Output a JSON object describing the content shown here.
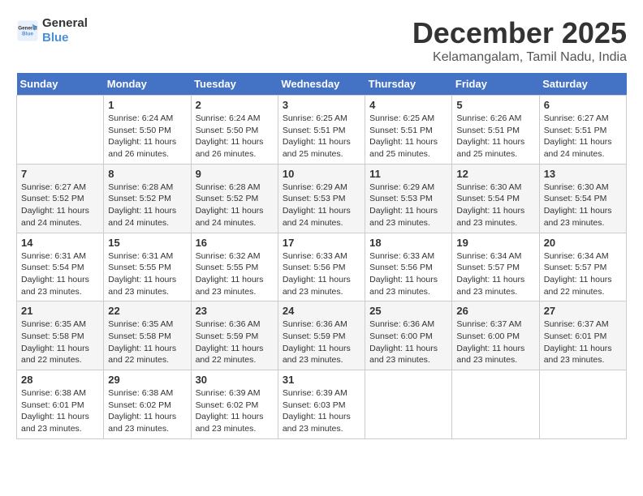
{
  "header": {
    "logo_line1": "General",
    "logo_line2": "Blue",
    "month": "December 2025",
    "location": "Kelamangalam, Tamil Nadu, India"
  },
  "weekdays": [
    "Sunday",
    "Monday",
    "Tuesday",
    "Wednesday",
    "Thursday",
    "Friday",
    "Saturday"
  ],
  "weeks": [
    [
      {
        "day": "",
        "info": ""
      },
      {
        "day": "1",
        "info": "Sunrise: 6:24 AM\nSunset: 5:50 PM\nDaylight: 11 hours\nand 26 minutes."
      },
      {
        "day": "2",
        "info": "Sunrise: 6:24 AM\nSunset: 5:50 PM\nDaylight: 11 hours\nand 26 minutes."
      },
      {
        "day": "3",
        "info": "Sunrise: 6:25 AM\nSunset: 5:51 PM\nDaylight: 11 hours\nand 25 minutes."
      },
      {
        "day": "4",
        "info": "Sunrise: 6:25 AM\nSunset: 5:51 PM\nDaylight: 11 hours\nand 25 minutes."
      },
      {
        "day": "5",
        "info": "Sunrise: 6:26 AM\nSunset: 5:51 PM\nDaylight: 11 hours\nand 25 minutes."
      },
      {
        "day": "6",
        "info": "Sunrise: 6:27 AM\nSunset: 5:51 PM\nDaylight: 11 hours\nand 24 minutes."
      }
    ],
    [
      {
        "day": "7",
        "info": "Sunrise: 6:27 AM\nSunset: 5:52 PM\nDaylight: 11 hours\nand 24 minutes."
      },
      {
        "day": "8",
        "info": "Sunrise: 6:28 AM\nSunset: 5:52 PM\nDaylight: 11 hours\nand 24 minutes."
      },
      {
        "day": "9",
        "info": "Sunrise: 6:28 AM\nSunset: 5:52 PM\nDaylight: 11 hours\nand 24 minutes."
      },
      {
        "day": "10",
        "info": "Sunrise: 6:29 AM\nSunset: 5:53 PM\nDaylight: 11 hours\nand 24 minutes."
      },
      {
        "day": "11",
        "info": "Sunrise: 6:29 AM\nSunset: 5:53 PM\nDaylight: 11 hours\nand 23 minutes."
      },
      {
        "day": "12",
        "info": "Sunrise: 6:30 AM\nSunset: 5:54 PM\nDaylight: 11 hours\nand 23 minutes."
      },
      {
        "day": "13",
        "info": "Sunrise: 6:30 AM\nSunset: 5:54 PM\nDaylight: 11 hours\nand 23 minutes."
      }
    ],
    [
      {
        "day": "14",
        "info": "Sunrise: 6:31 AM\nSunset: 5:54 PM\nDaylight: 11 hours\nand 23 minutes."
      },
      {
        "day": "15",
        "info": "Sunrise: 6:31 AM\nSunset: 5:55 PM\nDaylight: 11 hours\nand 23 minutes."
      },
      {
        "day": "16",
        "info": "Sunrise: 6:32 AM\nSunset: 5:55 PM\nDaylight: 11 hours\nand 23 minutes."
      },
      {
        "day": "17",
        "info": "Sunrise: 6:33 AM\nSunset: 5:56 PM\nDaylight: 11 hours\nand 23 minutes."
      },
      {
        "day": "18",
        "info": "Sunrise: 6:33 AM\nSunset: 5:56 PM\nDaylight: 11 hours\nand 23 minutes."
      },
      {
        "day": "19",
        "info": "Sunrise: 6:34 AM\nSunset: 5:57 PM\nDaylight: 11 hours\nand 23 minutes."
      },
      {
        "day": "20",
        "info": "Sunrise: 6:34 AM\nSunset: 5:57 PM\nDaylight: 11 hours\nand 22 minutes."
      }
    ],
    [
      {
        "day": "21",
        "info": "Sunrise: 6:35 AM\nSunset: 5:58 PM\nDaylight: 11 hours\nand 22 minutes."
      },
      {
        "day": "22",
        "info": "Sunrise: 6:35 AM\nSunset: 5:58 PM\nDaylight: 11 hours\nand 22 minutes."
      },
      {
        "day": "23",
        "info": "Sunrise: 6:36 AM\nSunset: 5:59 PM\nDaylight: 11 hours\nand 22 minutes."
      },
      {
        "day": "24",
        "info": "Sunrise: 6:36 AM\nSunset: 5:59 PM\nDaylight: 11 hours\nand 23 minutes."
      },
      {
        "day": "25",
        "info": "Sunrise: 6:36 AM\nSunset: 6:00 PM\nDaylight: 11 hours\nand 23 minutes."
      },
      {
        "day": "26",
        "info": "Sunrise: 6:37 AM\nSunset: 6:00 PM\nDaylight: 11 hours\nand 23 minutes."
      },
      {
        "day": "27",
        "info": "Sunrise: 6:37 AM\nSunset: 6:01 PM\nDaylight: 11 hours\nand 23 minutes."
      }
    ],
    [
      {
        "day": "28",
        "info": "Sunrise: 6:38 AM\nSunset: 6:01 PM\nDaylight: 11 hours\nand 23 minutes."
      },
      {
        "day": "29",
        "info": "Sunrise: 6:38 AM\nSunset: 6:02 PM\nDaylight: 11 hours\nand 23 minutes."
      },
      {
        "day": "30",
        "info": "Sunrise: 6:39 AM\nSunset: 6:02 PM\nDaylight: 11 hours\nand 23 minutes."
      },
      {
        "day": "31",
        "info": "Sunrise: 6:39 AM\nSunset: 6:03 PM\nDaylight: 11 hours\nand 23 minutes."
      },
      {
        "day": "",
        "info": ""
      },
      {
        "day": "",
        "info": ""
      },
      {
        "day": "",
        "info": ""
      }
    ]
  ]
}
